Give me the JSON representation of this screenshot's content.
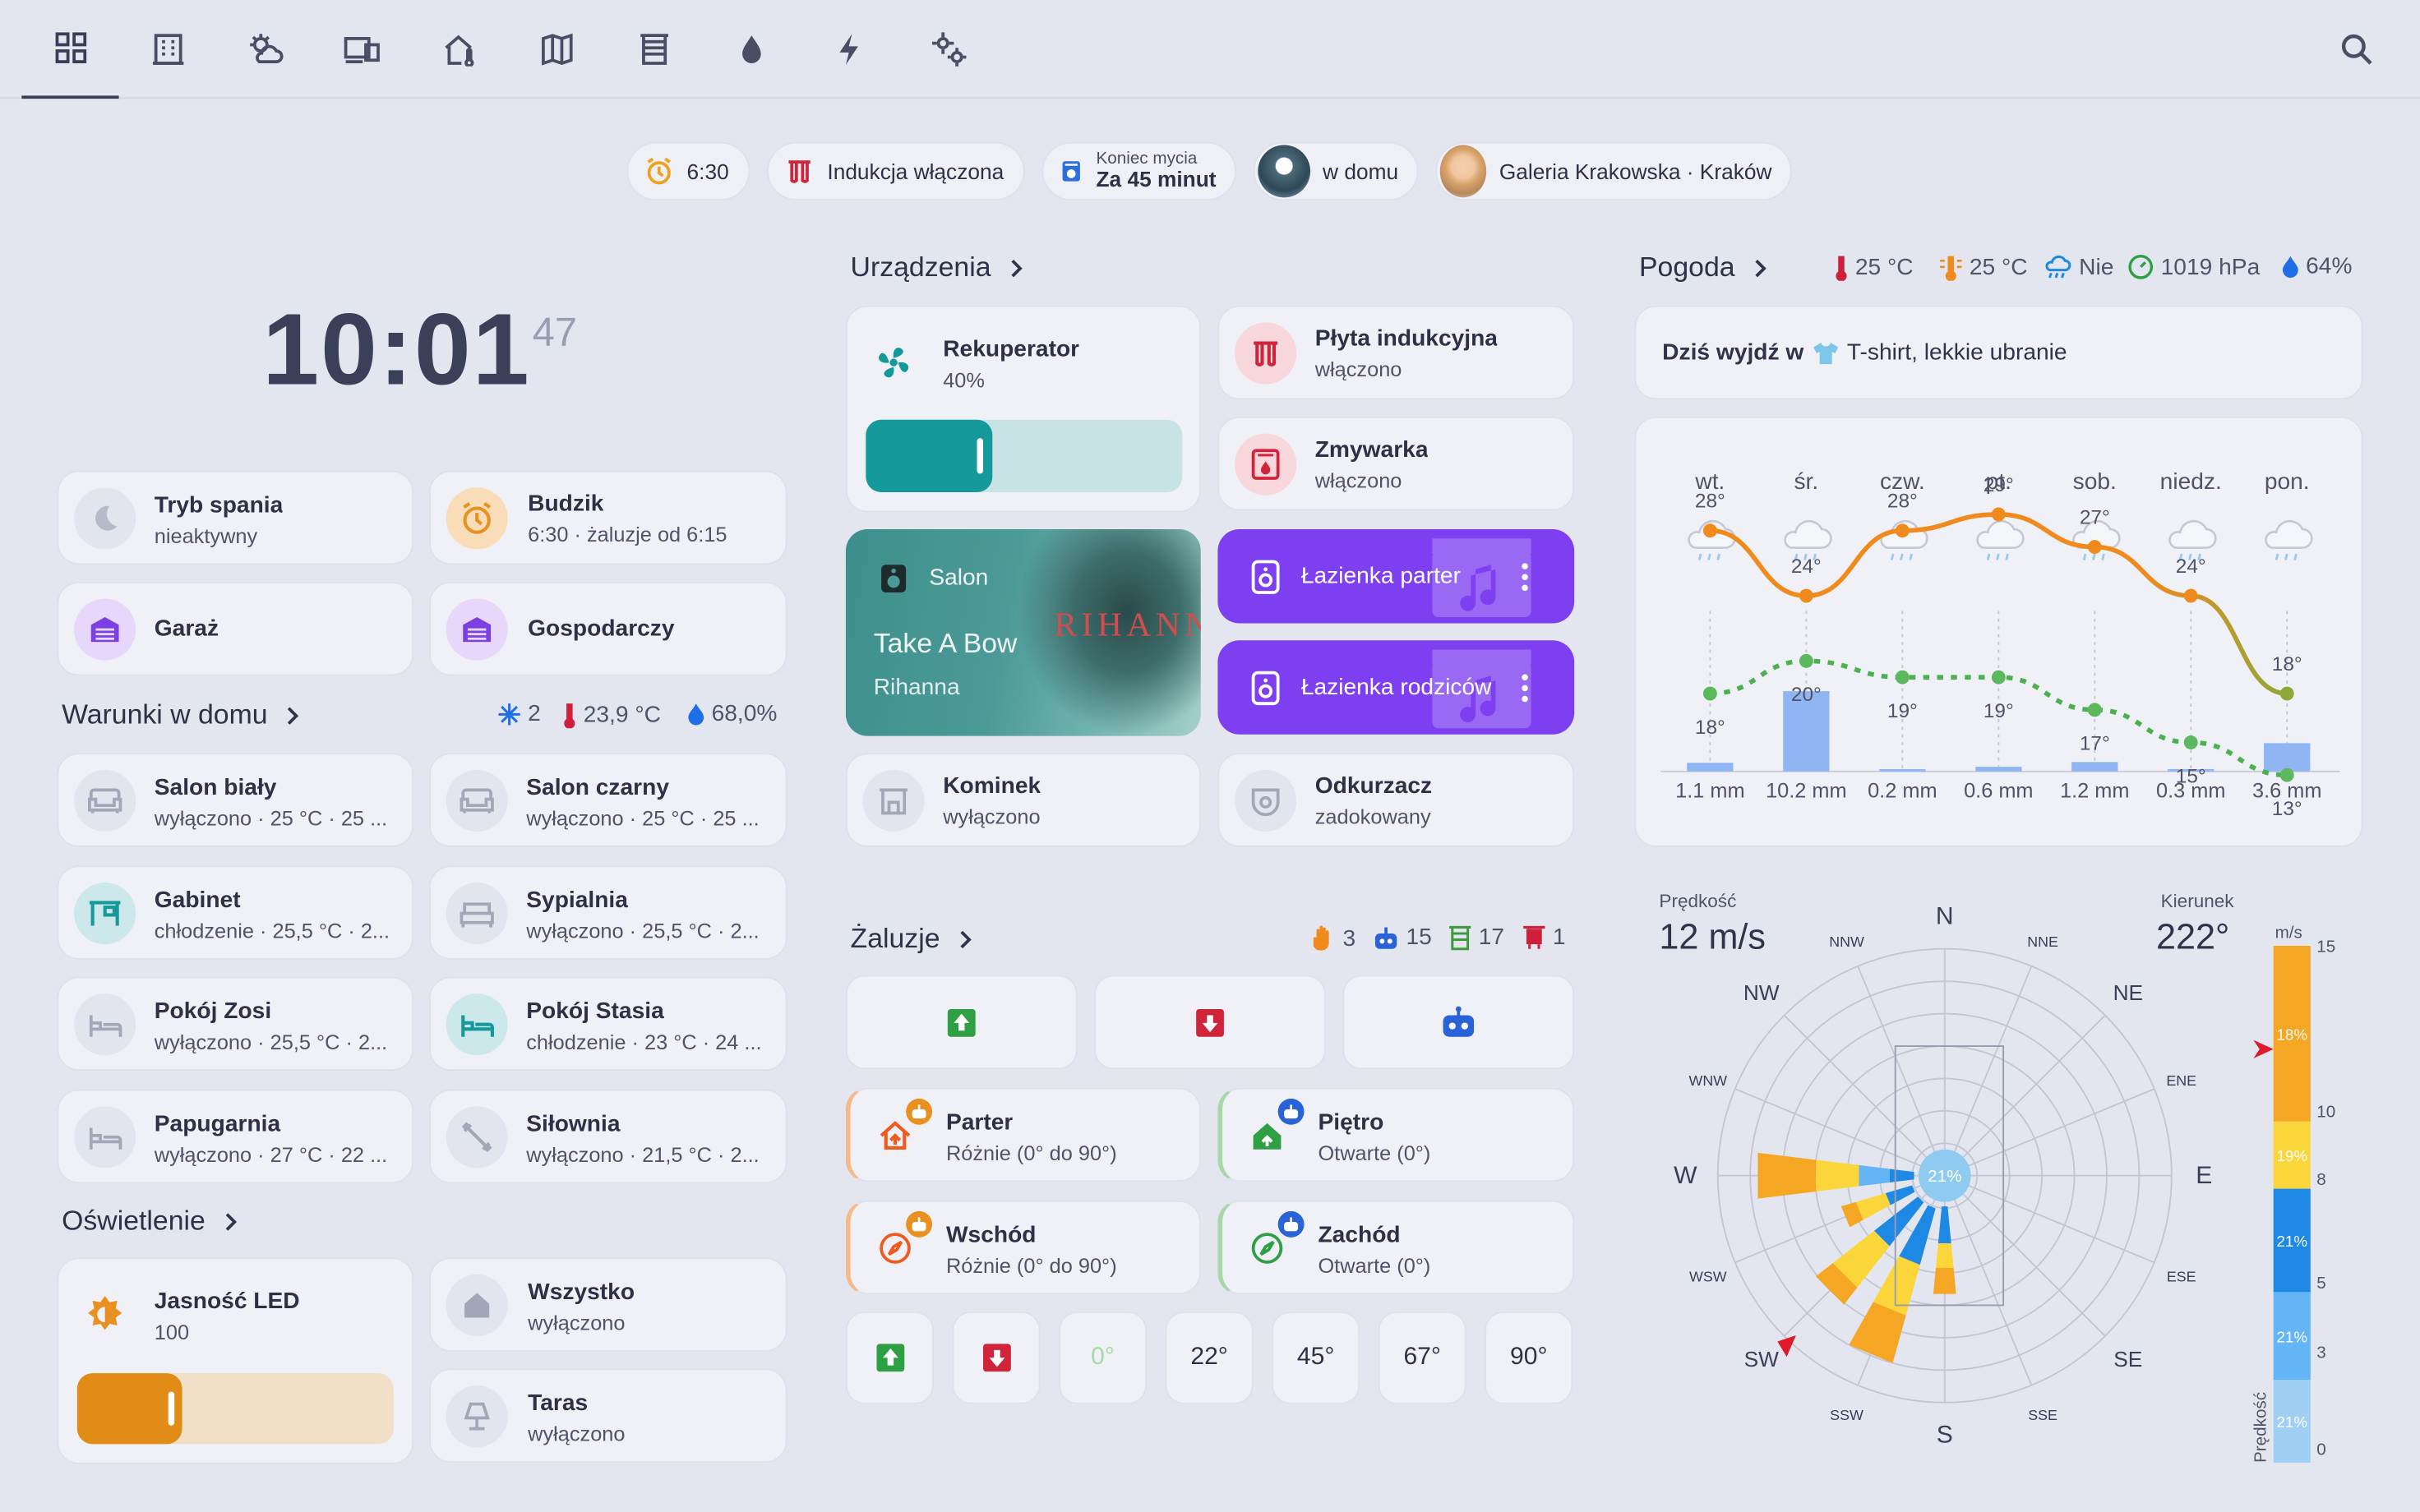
{
  "nav": {
    "tabs": [
      {
        "name": "dashboard-tab",
        "icon": "grid-icon"
      },
      {
        "name": "building-tab",
        "icon": "building-icon"
      },
      {
        "name": "weather-tab",
        "icon": "weather-cloud-sun-icon"
      },
      {
        "name": "devices-tab",
        "icon": "devices-icon"
      },
      {
        "name": "home-climate-tab",
        "icon": "home-thermometer-icon"
      },
      {
        "name": "map-tab",
        "icon": "map-icon"
      },
      {
        "name": "blinds-tab",
        "icon": "blinds-icon"
      },
      {
        "name": "water-tab",
        "icon": "water-drop-icon"
      },
      {
        "name": "energy-tab",
        "icon": "lightning-icon"
      },
      {
        "name": "settings-tab",
        "icon": "gears-icon"
      }
    ],
    "search_icon": "search-icon"
  },
  "chips": {
    "alarm": "6:30",
    "induction": "Indukcja włączona",
    "wash_title": "Koniec mycia",
    "wash_value": "Za 45 minut",
    "person1": "w domu",
    "person2": "Galeria Krakowska · Kraków"
  },
  "clock": {
    "time": "10:01",
    "seconds": "47"
  },
  "tiles": {
    "sleep": {
      "title": "Tryb spania",
      "sub": "nieaktywny"
    },
    "alarm": {
      "title": "Budzik",
      "sub": "6:30 · żaluzje od 6:15"
    },
    "garage": {
      "title": "Garaż"
    },
    "utility": {
      "title": "Gospodarczy"
    }
  },
  "conditions": {
    "title": "Warunki w domu",
    "ac_count": "2",
    "temp": "23,9 °C",
    "humidity": "68,0%",
    "rooms": [
      {
        "title": "Salon biały",
        "sub": "wyłączono · 25 °C · 25 ..."
      },
      {
        "title": "Salon czarny",
        "sub": "wyłączono · 25 °C · 25 ..."
      },
      {
        "title": "Gabinet",
        "sub": "chłodzenie · 25,5 °C · 2..."
      },
      {
        "title": "Sypialnia",
        "sub": "wyłączono · 25,5 °C · 2..."
      },
      {
        "title": "Pokój Zosi",
        "sub": "wyłączono · 25,5 °C · 2..."
      },
      {
        "title": "Pokój Stasia",
        "sub": "chłodzenie · 23 °C · 24 ..."
      },
      {
        "title": "Papugarnia",
        "sub": "wyłączono · 27 °C · 22 ..."
      },
      {
        "title": "Siłownia",
        "sub": "wyłączono · 21,5 °C · 2..."
      }
    ]
  },
  "lighting": {
    "title": "Oświetlenie",
    "led": {
      "title": "Jasność LED",
      "value": "100",
      "level": 0.33
    },
    "all": {
      "title": "Wszystko",
      "sub": "wyłączono"
    },
    "terrace": {
      "title": "Taras",
      "sub": "wyłączono"
    }
  },
  "devices": {
    "title": "Urządzenia",
    "recuperator": {
      "title": "Rekuperator",
      "sub": "40%",
      "level": 0.4
    },
    "induction": {
      "title": "Płyta indukcyjna",
      "sub": "włączono"
    },
    "dishwasher": {
      "title": "Zmywarka",
      "sub": "włączono"
    },
    "media": {
      "room": "Salon",
      "track": "Take A Bow",
      "artist": "Rihanna",
      "album_text": "RIHANNA"
    },
    "speaker1": "Łazienka parter",
    "speaker2": "Łazienka rodziców",
    "fireplace": {
      "title": "Kominek",
      "sub": "wyłączono"
    },
    "vacuum": {
      "title": "Odkurzacz",
      "sub": "zadokowany"
    }
  },
  "blinds": {
    "title": "Żaluzje",
    "manual": "3",
    "auto": "15",
    "open": "17",
    "closed": "1",
    "groups": [
      {
        "title": "Parter",
        "sub": "Różnie (0° do 90°)"
      },
      {
        "title": "Piętro",
        "sub": "Otwarte (0°)"
      },
      {
        "title": "Wschód",
        "sub": "Różnie (0° do 90°)"
      },
      {
        "title": "Zachód",
        "sub": "Otwarte (0°)"
      }
    ],
    "angles": [
      "0°",
      "22°",
      "45°",
      "67°",
      "90°"
    ]
  },
  "weather": {
    "title": "Pogoda",
    "temp": "25 °C",
    "feels": "25 °C",
    "rain": "Nie",
    "pressure": "1019 hPa",
    "humidity": "64%",
    "advice_prefix": "Dziś wyjdź w",
    "advice": "T-shirt, lekkie ubranie"
  },
  "chart_data": [
    {
      "type": "line",
      "categories": [
        "wt.",
        "śr.",
        "czw.",
        "pt.",
        "sob.",
        "niedz.",
        "pon."
      ],
      "series": [
        {
          "role": "high",
          "values": [
            28,
            24,
            28,
            29,
            27,
            24,
            18
          ],
          "color": "#f08a1c"
        },
        {
          "role": "low",
          "values": [
            18,
            20,
            19,
            19,
            17,
            15,
            13
          ],
          "color": "#4caf50"
        }
      ],
      "precipitation": [
        "1.1 mm",
        "10.2 mm",
        "0.2 mm",
        "0.6 mm",
        "1.2 mm",
        "0.3 mm",
        "3.6 mm"
      ],
      "precipitation_values": [
        1.1,
        10.2,
        0.2,
        0.6,
        1.2,
        0.3,
        3.6
      ],
      "high_labels": [
        "28°",
        "24°",
        "28°",
        "29°",
        "27°",
        "24°",
        "18°"
      ],
      "low_labels": [
        "18°",
        "20°",
        "19°",
        "19°",
        "17°",
        "15°",
        "13°"
      ]
    },
    {
      "type": "windrose",
      "speed_label": "Prędkość",
      "speed": "12 m/s",
      "direction_label": "Kierunek",
      "direction": "222°",
      "center_label": "21%",
      "directions": [
        "N",
        "NNE",
        "NE",
        "ENE",
        "E",
        "ESE",
        "SE",
        "SSE",
        "S",
        "SSW",
        "SW",
        "WSW",
        "W",
        "WNW",
        "NW",
        "NNW"
      ],
      "scale": {
        "unit": "m/s",
        "label": "Prędkość",
        "ticks": [
          "15",
          "10",
          "8",
          "5",
          "3",
          "0"
        ],
        "bands": [
          {
            "label": "18%",
            "color": "#f5a623"
          },
          {
            "label": "19%",
            "color": "#fbd63a"
          },
          {
            "label": "21%",
            "color": "#1e88e5"
          },
          {
            "label": "21%",
            "color": "#64b5f6"
          },
          {
            "label": "21%",
            "color": "#9fd0f3"
          }
        ]
      }
    }
  ]
}
